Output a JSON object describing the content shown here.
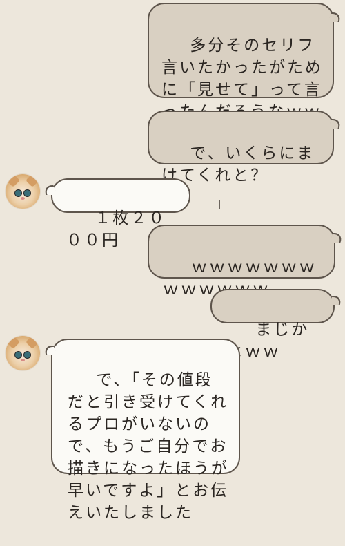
{
  "chat": {
    "messages": [
      {
        "side": "out",
        "text": "多分そのセリフ言いたかったがために「見せて」って言ったんだろうなｗｗｗｗｗｗ"
      },
      {
        "side": "out",
        "text": "で、いくらにまけてくれと？"
      },
      {
        "side": "in",
        "sender_icon": "cat-avatar-icon",
        "text": "１枚２０００円"
      },
      {
        "side": "out",
        "text": "ｗｗｗｗｗｗｗｗｗｗｗｗｗ"
      },
      {
        "side": "out",
        "text": "まじかよｗｗ"
      },
      {
        "side": "in",
        "sender_icon": "cat-avatar-icon",
        "text": "で、「その値段だと引き受けてくれるプロがいないので、もうご自分でお描きになったほうが早いですよ」とお伝えいたしました"
      }
    ]
  }
}
